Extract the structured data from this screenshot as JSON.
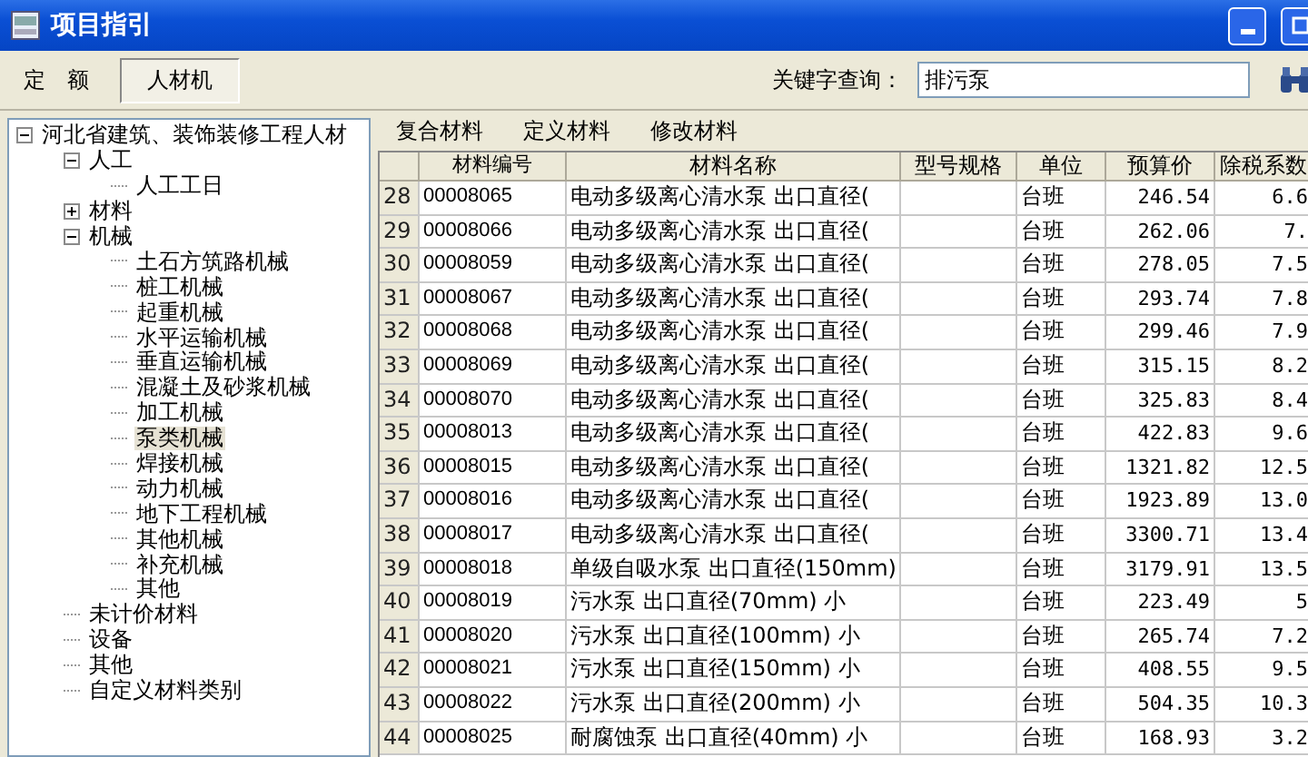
{
  "window": {
    "title": "项目指引"
  },
  "tabs": [
    {
      "label": "定　额",
      "selected": false
    },
    {
      "label": "人材机",
      "selected": true
    }
  ],
  "search": {
    "label": "关键字查询：",
    "value": "排污泵"
  },
  "tree": [
    {
      "label": "河北省建筑、装饰装修工程人材",
      "expanded": true,
      "selected": false,
      "children": [
        {
          "label": "人工",
          "expanded": true,
          "selected": false,
          "children": [
            {
              "label": "人工工日",
              "selected": false
            }
          ]
        },
        {
          "label": "材料",
          "expanded": false,
          "selected": false
        },
        {
          "label": "机械",
          "expanded": true,
          "selected": false,
          "children": [
            {
              "label": "土石方筑路机械",
              "selected": false
            },
            {
              "label": "桩工机械",
              "selected": false
            },
            {
              "label": "起重机械",
              "selected": false
            },
            {
              "label": "水平运输机械",
              "selected": false
            },
            {
              "label": "垂直运输机械",
              "selected": false
            },
            {
              "label": "混凝土及砂浆机械",
              "selected": false
            },
            {
              "label": "加工机械",
              "selected": false
            },
            {
              "label": "泵类机械",
              "selected": true
            },
            {
              "label": "焊接机械",
              "selected": false
            },
            {
              "label": "动力机械",
              "selected": false
            },
            {
              "label": "地下工程机械",
              "selected": false
            },
            {
              "label": "其他机械",
              "selected": false
            },
            {
              "label": "补充机械",
              "selected": false
            },
            {
              "label": "其他",
              "selected": false
            }
          ]
        },
        {
          "label": "未计价材料",
          "selected": false
        },
        {
          "label": "设备",
          "selected": false
        },
        {
          "label": "其他",
          "selected": false
        },
        {
          "label": "自定义材料类别",
          "selected": false
        }
      ]
    }
  ],
  "sub_tabs": [
    "复合材料",
    "定义材料",
    "修改材料"
  ],
  "table": {
    "columns": [
      "材料编号",
      "材料名称",
      "型号规格",
      "单位",
      "预算价",
      "除税系数"
    ],
    "rows": [
      {
        "index": "28",
        "cells": [
          "00008065",
          "电动多级离心清水泵 出口直径(",
          "",
          "台班",
          "246.54",
          "6.6"
        ]
      },
      {
        "index": "29",
        "cells": [
          "00008066",
          "电动多级离心清水泵 出口直径(",
          "",
          "台班",
          "262.06",
          "7."
        ]
      },
      {
        "index": "30",
        "cells": [
          "00008059",
          "电动多级离心清水泵 出口直径(",
          "",
          "台班",
          "278.05",
          "7.5"
        ]
      },
      {
        "index": "31",
        "cells": [
          "00008067",
          "电动多级离心清水泵 出口直径(",
          "",
          "台班",
          "293.74",
          "7.8"
        ]
      },
      {
        "index": "32",
        "cells": [
          "00008068",
          "电动多级离心清水泵 出口直径(",
          "",
          "台班",
          "299.46",
          "7.9"
        ]
      },
      {
        "index": "33",
        "cells": [
          "00008069",
          "电动多级离心清水泵 出口直径(",
          "",
          "台班",
          "315.15",
          "8.2"
        ]
      },
      {
        "index": "34",
        "cells": [
          "00008070",
          "电动多级离心清水泵 出口直径(",
          "",
          "台班",
          "325.83",
          "8.4"
        ]
      },
      {
        "index": "35",
        "cells": [
          "00008013",
          "电动多级离心清水泵 出口直径(",
          "",
          "台班",
          "422.83",
          "9.6"
        ]
      },
      {
        "index": "36",
        "cells": [
          "00008015",
          "电动多级离心清水泵 出口直径(",
          "",
          "台班",
          "1321.82",
          "12.5"
        ]
      },
      {
        "index": "37",
        "cells": [
          "00008016",
          "电动多级离心清水泵 出口直径(",
          "",
          "台班",
          "1923.89",
          "13.0"
        ]
      },
      {
        "index": "38",
        "cells": [
          "00008017",
          "电动多级离心清水泵 出口直径(",
          "",
          "台班",
          "3300.71",
          "13.4"
        ]
      },
      {
        "index": "39",
        "cells": [
          "00008018",
          "单级自吸水泵 出口直径(150mm)",
          "",
          "台班",
          "3179.91",
          "13.5"
        ]
      },
      {
        "index": "40",
        "cells": [
          "00008019",
          "污水泵 出口直径(70mm) 小",
          "",
          "台班",
          "223.49",
          "5"
        ]
      },
      {
        "index": "41",
        "cells": [
          "00008020",
          "污水泵 出口直径(100mm) 小",
          "",
          "台班",
          "265.74",
          "7.2"
        ]
      },
      {
        "index": "42",
        "cells": [
          "00008021",
          "污水泵 出口直径(150mm) 小",
          "",
          "台班",
          "408.55",
          "9.5"
        ]
      },
      {
        "index": "43",
        "cells": [
          "00008022",
          "污水泵 出口直径(200mm) 小",
          "",
          "台班",
          "504.35",
          "10.3"
        ]
      },
      {
        "index": "44",
        "cells": [
          "00008025",
          "耐腐蚀泵 出口直径(40mm) 小",
          "",
          "台班",
          "168.93",
          "3.2"
        ]
      }
    ]
  }
}
